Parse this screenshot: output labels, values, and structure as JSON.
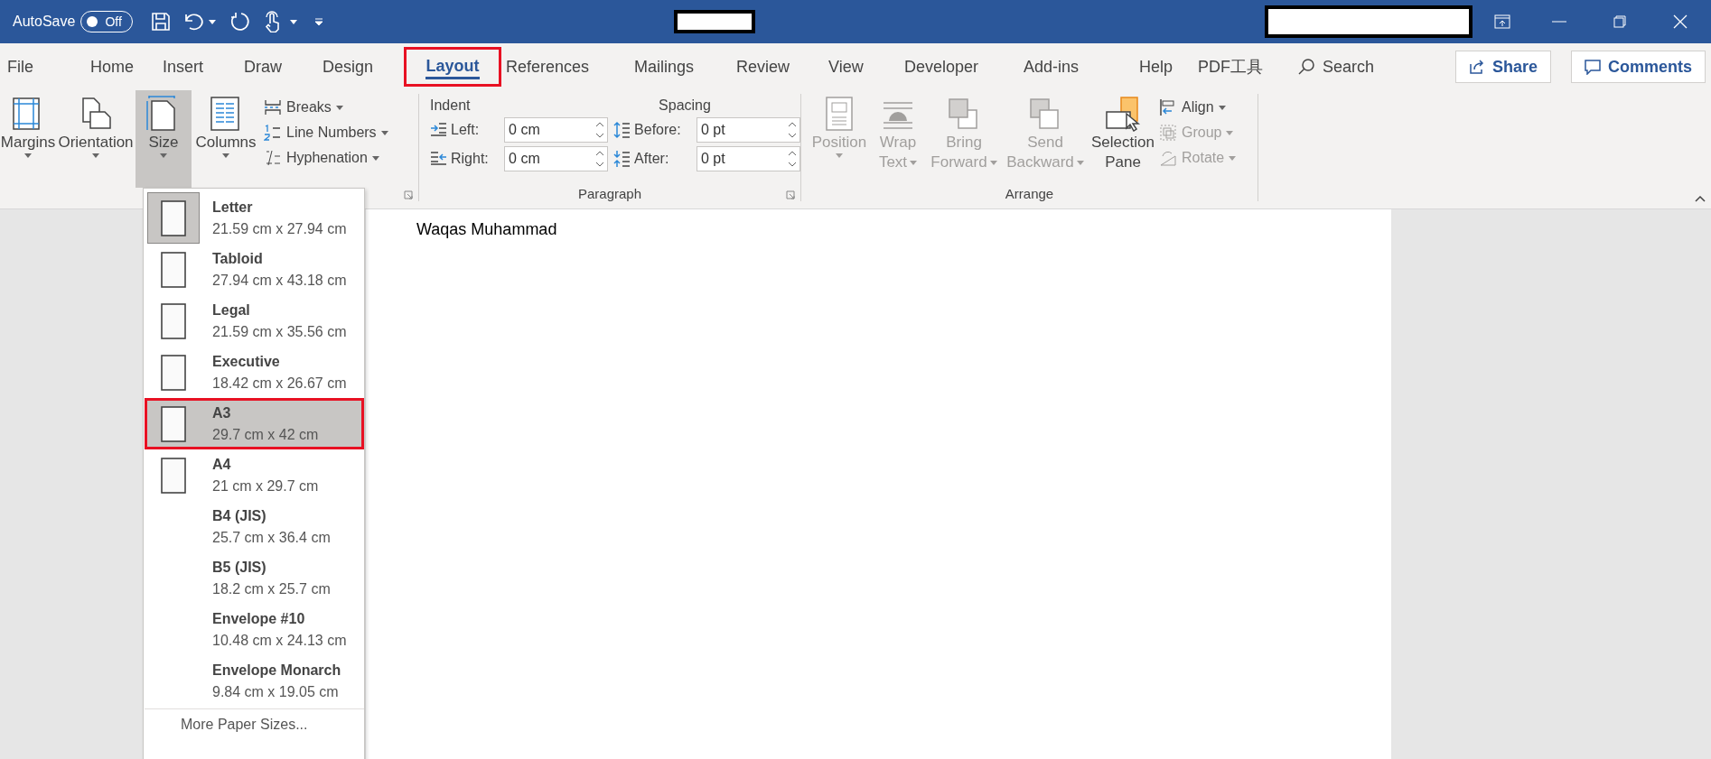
{
  "title_bar": {
    "autosave_label": "AutoSave",
    "autosave_toggle": {
      "on": false,
      "label": "Off"
    }
  },
  "tabs": [
    {
      "label": "File",
      "selected": false,
      "highlighted": false
    },
    {
      "label": "Home",
      "selected": false,
      "highlighted": false
    },
    {
      "label": "Insert",
      "selected": false,
      "highlighted": false
    },
    {
      "label": "Draw",
      "selected": false,
      "highlighted": false
    },
    {
      "label": "Design",
      "selected": false,
      "highlighted": false
    },
    {
      "label": "Layout",
      "selected": true,
      "highlighted": true
    },
    {
      "label": "References",
      "selected": false,
      "highlighted": false
    },
    {
      "label": "Mailings",
      "selected": false,
      "highlighted": false
    },
    {
      "label": "Review",
      "selected": false,
      "highlighted": false
    },
    {
      "label": "View",
      "selected": false,
      "highlighted": false
    },
    {
      "label": "Developer",
      "selected": false,
      "highlighted": false
    },
    {
      "label": "Add-ins",
      "selected": false,
      "highlighted": false
    },
    {
      "label": "Help",
      "selected": false,
      "highlighted": false
    },
    {
      "label": "PDF工具",
      "selected": false,
      "highlighted": false
    }
  ],
  "search": {
    "label": "Search"
  },
  "share_button": "Share",
  "comments_button": "Comments",
  "page_setup": {
    "large_buttons": [
      {
        "kind": "margins",
        "lines": [
          "Margins"
        ],
        "selected": false
      },
      {
        "kind": "orientation",
        "lines": [
          "Orientation"
        ],
        "selected": false
      },
      {
        "kind": "size",
        "lines": [
          "Size"
        ],
        "selected": true
      },
      {
        "kind": "columns",
        "lines": [
          "Columns"
        ],
        "selected": false
      }
    ],
    "small_buttons": [
      {
        "kind": "breaks",
        "label": "Breaks"
      },
      {
        "kind": "line-numbers",
        "label": "Line Numbers"
      },
      {
        "kind": "hyphenation",
        "label": "Hyphenation"
      }
    ]
  },
  "paragraph": {
    "title": "Paragraph",
    "indent_heading": "Indent",
    "spacing_heading": "Spacing",
    "fields": [
      {
        "kind": "indent-left",
        "label": "Left:",
        "value": "0 cm"
      },
      {
        "kind": "spacing-before",
        "label": "Before:",
        "value": "0 pt"
      },
      {
        "kind": "indent-right",
        "label": "Right:",
        "value": "0 cm"
      },
      {
        "kind": "spacing-after",
        "label": "After:",
        "value": "0 pt"
      }
    ]
  },
  "arrange": {
    "title": "Arrange",
    "large_buttons": [
      {
        "kind": "position",
        "lines": [
          "Position"
        ],
        "dropdown": true,
        "disabled": true
      },
      {
        "kind": "wrap",
        "lines": [
          "Wrap",
          "Text"
        ],
        "dropdown": true,
        "disabled": true
      },
      {
        "kind": "bring",
        "lines": [
          "Bring",
          "Forward"
        ],
        "dropdown": true,
        "disabled": true
      },
      {
        "kind": "send",
        "lines": [
          "Send",
          "Backward"
        ],
        "dropdown": true,
        "disabled": true
      },
      {
        "kind": "selection",
        "lines": [
          "Selection",
          "Pane"
        ],
        "dropdown": false,
        "disabled": false
      }
    ],
    "small_buttons": [
      {
        "kind": "align",
        "label": "Align",
        "disabled": false
      },
      {
        "kind": "group",
        "label": "Group",
        "disabled": true
      },
      {
        "kind": "rotate",
        "label": "Rotate",
        "disabled": true
      }
    ]
  },
  "document": {
    "text": "Waqas Muhammad"
  },
  "size_menu": {
    "items": [
      {
        "name": "Letter",
        "dimensions": "21.59 cm x 27.94 cm",
        "kind": "with-icon",
        "selected": true,
        "highlighted": false
      },
      {
        "name": "Tabloid",
        "dimensions": "27.94 cm x 43.18 cm",
        "kind": "with-icon",
        "selected": false,
        "highlighted": false
      },
      {
        "name": "Legal",
        "dimensions": "21.59 cm x 35.56 cm",
        "kind": "with-icon",
        "selected": false,
        "highlighted": false
      },
      {
        "name": "Executive",
        "dimensions": "18.42 cm x 26.67 cm",
        "kind": "with-icon",
        "selected": false,
        "highlighted": false
      },
      {
        "name": "A3",
        "dimensions": "29.7 cm x 42 cm",
        "kind": "with-icon",
        "selected": false,
        "highlighted": true
      },
      {
        "name": "A4",
        "dimensions": "21 cm x 29.7 cm",
        "kind": "with-icon",
        "selected": false,
        "highlighted": false
      },
      {
        "name": "B4 (JIS)",
        "dimensions": "25.7 cm x 36.4 cm",
        "kind": "plain",
        "selected": false,
        "highlighted": false
      },
      {
        "name": "B5 (JIS)",
        "dimensions": "18.2 cm x 25.7 cm",
        "kind": "plain",
        "selected": false,
        "highlighted": false
      },
      {
        "name": "Envelope #10",
        "dimensions": "10.48 cm x 24.13 cm",
        "kind": "plain",
        "selected": false,
        "highlighted": false
      },
      {
        "name": "Envelope Monarch",
        "dimensions": "9.84 cm x 19.05 cm",
        "kind": "plain",
        "selected": false,
        "highlighted": false
      }
    ],
    "more": "More Paper Sizes..."
  }
}
